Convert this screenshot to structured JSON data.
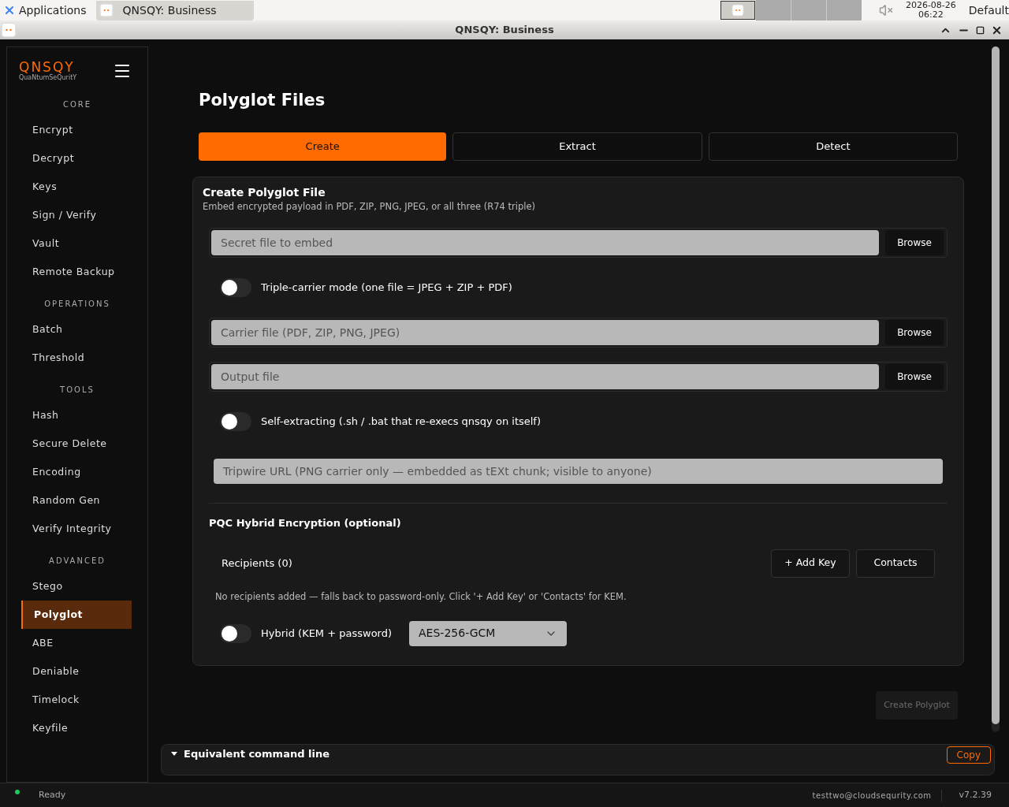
{
  "taskbar": {
    "menu": "Applications",
    "task": "QNSQY: Business",
    "date": "2026-08-26",
    "time": "06:22",
    "layout": "Default",
    "muted": true
  },
  "window": {
    "title": "QNSQY: Business"
  },
  "sidebar": {
    "logo": "QNSQY",
    "tagline": "QuaNtumSeQuritY",
    "sections": [
      {
        "title": "CORE",
        "items": [
          {
            "label": "Encrypt",
            "selected": false
          },
          {
            "label": "Decrypt",
            "selected": false
          },
          {
            "label": "Keys",
            "selected": false
          },
          {
            "label": "Sign / Verify",
            "selected": false
          },
          {
            "label": "Vault",
            "selected": false
          },
          {
            "label": "Remote Backup",
            "selected": false
          }
        ]
      },
      {
        "title": "OPERATIONS",
        "items": [
          {
            "label": "Batch",
            "selected": false
          },
          {
            "label": "Threshold",
            "selected": false
          }
        ]
      },
      {
        "title": "TOOLS",
        "items": [
          {
            "label": "Hash",
            "selected": false
          },
          {
            "label": "Secure Delete",
            "selected": false
          },
          {
            "label": "Encoding",
            "selected": false
          },
          {
            "label": "Random Gen",
            "selected": false
          },
          {
            "label": "Verify Integrity",
            "selected": false
          }
        ]
      },
      {
        "title": "ADVANCED",
        "items": [
          {
            "label": "Stego",
            "selected": false
          },
          {
            "label": "Polyglot",
            "selected": true
          },
          {
            "label": "ABE",
            "selected": false
          },
          {
            "label": "Deniable",
            "selected": false
          },
          {
            "label": "Timelock",
            "selected": false
          },
          {
            "label": "Keyfile",
            "selected": false
          }
        ]
      }
    ]
  },
  "page": {
    "title": "Polyglot Files",
    "tabs": [
      {
        "label": "Create",
        "selected": true
      },
      {
        "label": "Extract",
        "selected": false
      },
      {
        "label": "Detect",
        "selected": false
      }
    ],
    "card": {
      "title": "Create Polyglot File",
      "subtitle": "Embed encrypted payload in PDF, ZIP, PNG, JPEG, or all three (R74 triple)",
      "rows": [
        {
          "kind": "file",
          "placeholder": "Secret file to embed",
          "button": "Browse"
        },
        {
          "kind": "toggle",
          "label": "Triple-carrier mode (one file = JPEG + ZIP + PDF)",
          "on": false
        },
        {
          "kind": "file",
          "placeholder": "Carrier file (PDF, ZIP, PNG, JPEG)",
          "button": "Browse"
        },
        {
          "kind": "file",
          "placeholder": "Output file",
          "button": "Browse"
        },
        {
          "kind": "toggle",
          "label": "Self-extracting (.sh / .bat that re-execs qnsqy on itself)",
          "on": false
        },
        {
          "kind": "field",
          "placeholder": "Tripwire URL (PNG carrier only — embedded as tEXt chunk; visible to anyone)"
        }
      ],
      "pqc": {
        "title": "PQC Hybrid Encryption (optional)",
        "recipients": "Recipients (0)",
        "add_key": "+ Add Key",
        "contacts": "Contacts",
        "note": "No recipients added — falls back to password-only. Click '+ Add Key' or 'Contacts' for KEM.",
        "hybrid": {
          "label": "Hybrid (KEM + password)",
          "on": false
        },
        "cipher": "AES-256-GCM"
      }
    },
    "submit": {
      "label": "Create Polyglot",
      "disabled": true
    },
    "cli": {
      "title": "Equivalent command line",
      "expanded": true,
      "copy": "Copy"
    }
  },
  "status_bar": {
    "status": "Ready",
    "color": "#22c55e",
    "user": "testtwo@cloudsequrity.com",
    "version": "v7.2.39"
  }
}
